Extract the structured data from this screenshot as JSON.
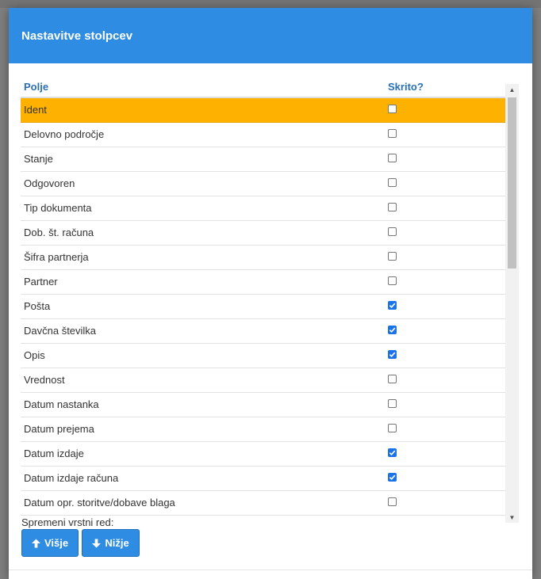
{
  "modal": {
    "title": "Nastavitve stolpcev",
    "table": {
      "headers": {
        "field": "Polje",
        "hidden": "Skrito?"
      },
      "rows": [
        {
          "label": "Ident",
          "hidden": false,
          "selected": true
        },
        {
          "label": "Delovno področje",
          "hidden": false
        },
        {
          "label": "Stanje",
          "hidden": false
        },
        {
          "label": "Odgovoren",
          "hidden": false
        },
        {
          "label": "Tip dokumenta",
          "hidden": false
        },
        {
          "label": "Dob. št. računa",
          "hidden": false
        },
        {
          "label": "Šifra partnerja",
          "hidden": false
        },
        {
          "label": "Partner",
          "hidden": false
        },
        {
          "label": "Pošta",
          "hidden": true
        },
        {
          "label": "Davčna številka",
          "hidden": true
        },
        {
          "label": "Opis",
          "hidden": true
        },
        {
          "label": "Vrednost",
          "hidden": false
        },
        {
          "label": "Datum nastanka",
          "hidden": false
        },
        {
          "label": "Datum prejema",
          "hidden": false
        },
        {
          "label": "Datum izdaje",
          "hidden": true
        },
        {
          "label": "Datum izdaje računa",
          "hidden": true
        },
        {
          "label": "Datum opr. storitve/dobave blaga",
          "hidden": false
        }
      ]
    },
    "order_label": "Spremeni vrstni red:",
    "buttons": {
      "up": "Višje",
      "down": "Nižje"
    }
  },
  "colors": {
    "header_bg": "#2e8de3",
    "selected_row": "#ffb100",
    "checkbox_checked": "#1a73e8",
    "column_header_text": "#2a6fb3"
  },
  "icons": {
    "up": "arrow-up-icon",
    "down": "arrow-down-icon"
  }
}
